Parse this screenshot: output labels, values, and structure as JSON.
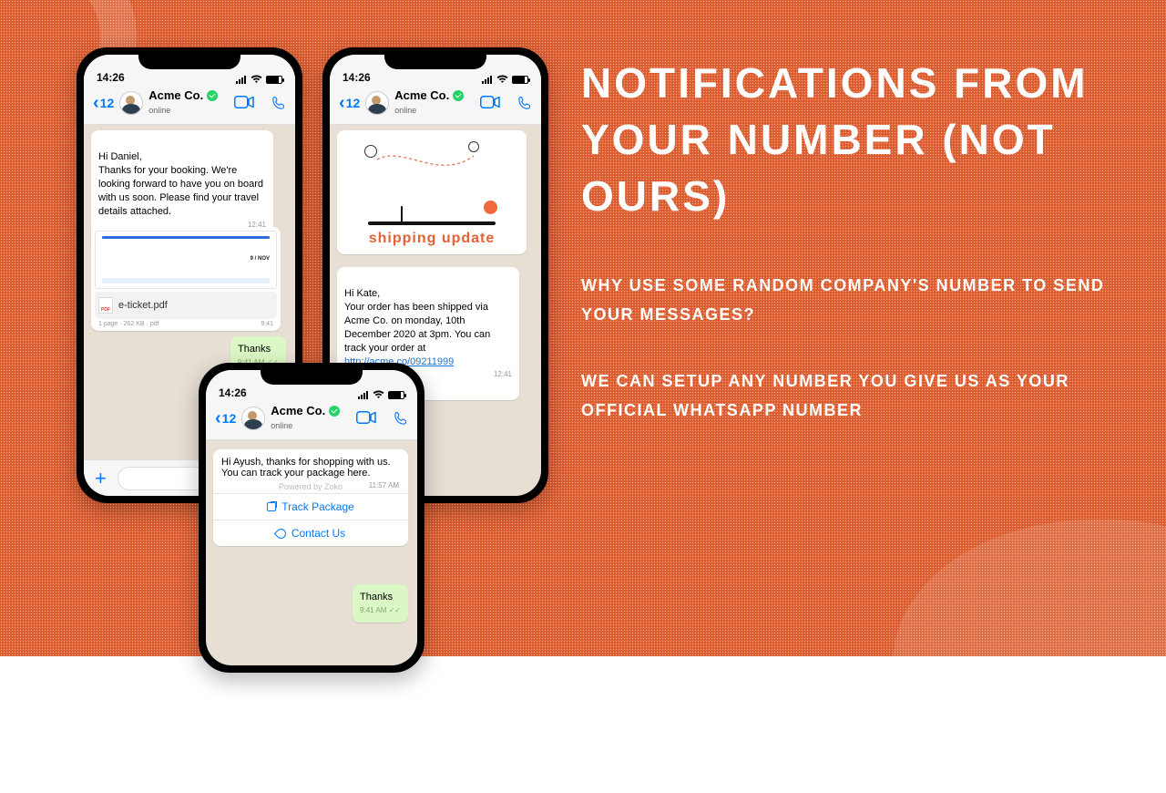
{
  "copy": {
    "headline": "NOTIFICATIONS FROM YOUR NUMBER (NOT OURS)",
    "sub1": "WHY USE SOME RANDOM COMPANY'S NUMBER TO SEND YOUR MESSAGES?",
    "sub2": "WE CAN SETUP ANY NUMBER YOU GIVE US AS YOUR OFFICIAL WHATSAPP NUMBER"
  },
  "common": {
    "clock": "14:26",
    "back_count": "12",
    "contact": "Acme Co.",
    "status": "online",
    "reply": "Thanks",
    "reply_time": "9:41 AM ✓✓"
  },
  "phoneA": {
    "msg": "Hi Daniel,\nThanks for your booking. We're looking forward to have you on board with us soon. Please find your travel details attached.",
    "msg_time": "12:41",
    "doc_date": "9 / NOV",
    "file_name": "e-ticket.pdf",
    "file_meta_left": "1 page · 262 KB · pdf",
    "file_meta_right": "9:41"
  },
  "phoneB": {
    "ship_title": "shipping update",
    "msg_pre": "Hi Kate,\nYour order has been shipped via Acme Co. on monday, 10th December 2020 at 3pm. You can track your order at ",
    "link": "http://acme.co/09211999",
    "msg_time": "12:41"
  },
  "phoneC": {
    "msg": "Hi Ayush, thanks for shopping with us. You can track your package here.",
    "powered": "Powered by Zoko",
    "time": "11:57 AM",
    "btn1": "Track Package",
    "btn2": "Contact Us"
  }
}
